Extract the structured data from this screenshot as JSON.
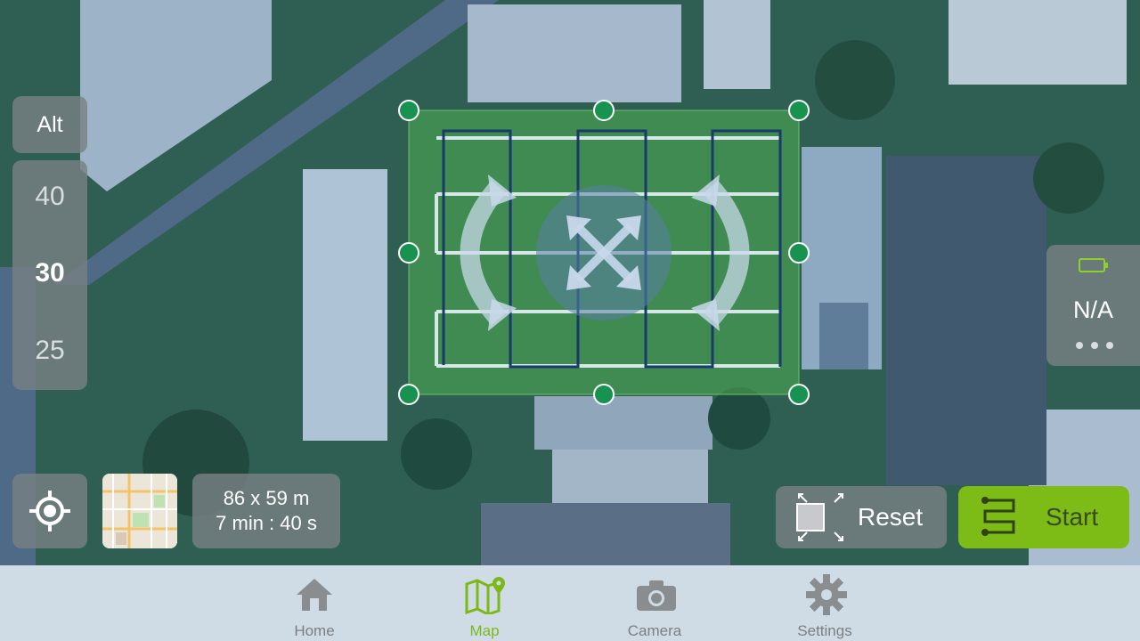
{
  "altitude": {
    "label": "Alt",
    "values": [
      "40",
      "30",
      "25"
    ],
    "selected": "30"
  },
  "survey_info": {
    "dimensions": "86 x 59 m",
    "duration": "7 min : 40 s"
  },
  "battery": {
    "value": "N/A",
    "icon": "battery-icon",
    "more_icon": "more-dots-icon"
  },
  "actions": {
    "reset_label": "Reset",
    "start_label": "Start"
  },
  "tabs": [
    {
      "label": "Home",
      "icon": "home-icon"
    },
    {
      "label": "Map",
      "icon": "map-icon"
    },
    {
      "label": "Camera",
      "icon": "camera-icon"
    },
    {
      "label": "Settings",
      "icon": "gear-icon"
    }
  ],
  "active_tab": "Map",
  "colors": {
    "accent": "#7dbb16",
    "survey_area": "#4caf50",
    "handle": "#17924f",
    "flight_path": "#1a3a6b"
  }
}
